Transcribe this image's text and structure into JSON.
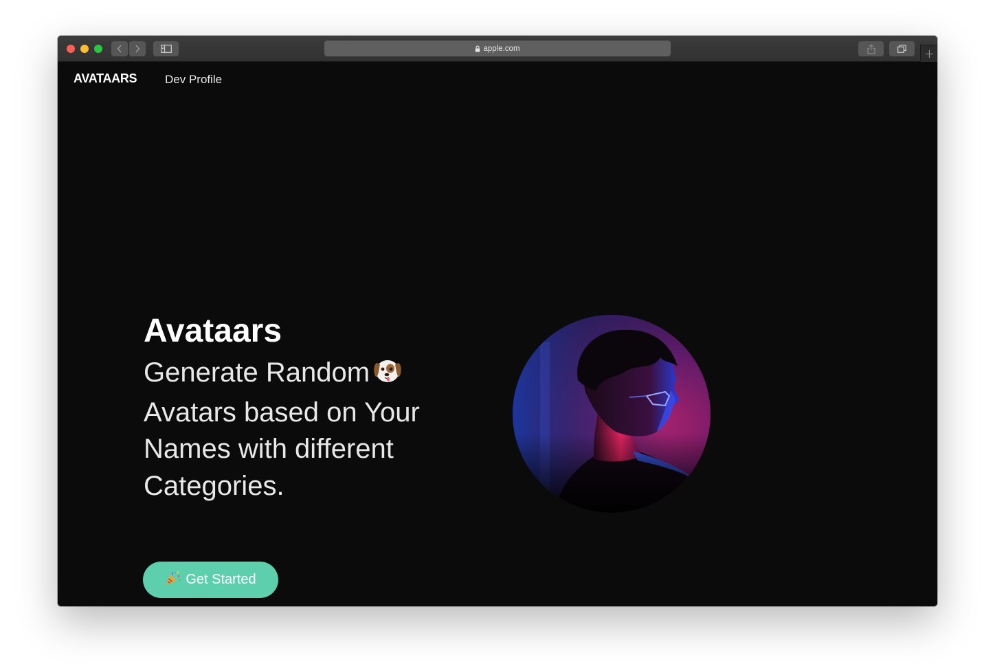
{
  "browser": {
    "url": "apple.com"
  },
  "nav": {
    "brand": "AVATAARS",
    "links": [
      "Dev Profile"
    ]
  },
  "hero": {
    "title": "Avataars",
    "subtitle_line1": "Generate Random",
    "subtitle_rest": "Avatars based on Your Names with different Categories.",
    "cta_label": "Get Started"
  },
  "icons": {
    "lock": "lock-icon",
    "dog": "dog-face-icon",
    "party": "party-popper-icon",
    "portrait": "person-portrait-image"
  },
  "colors": {
    "page_bg": "#0b0b0b",
    "accent": "#5ecfad",
    "text": "#ffffff"
  }
}
